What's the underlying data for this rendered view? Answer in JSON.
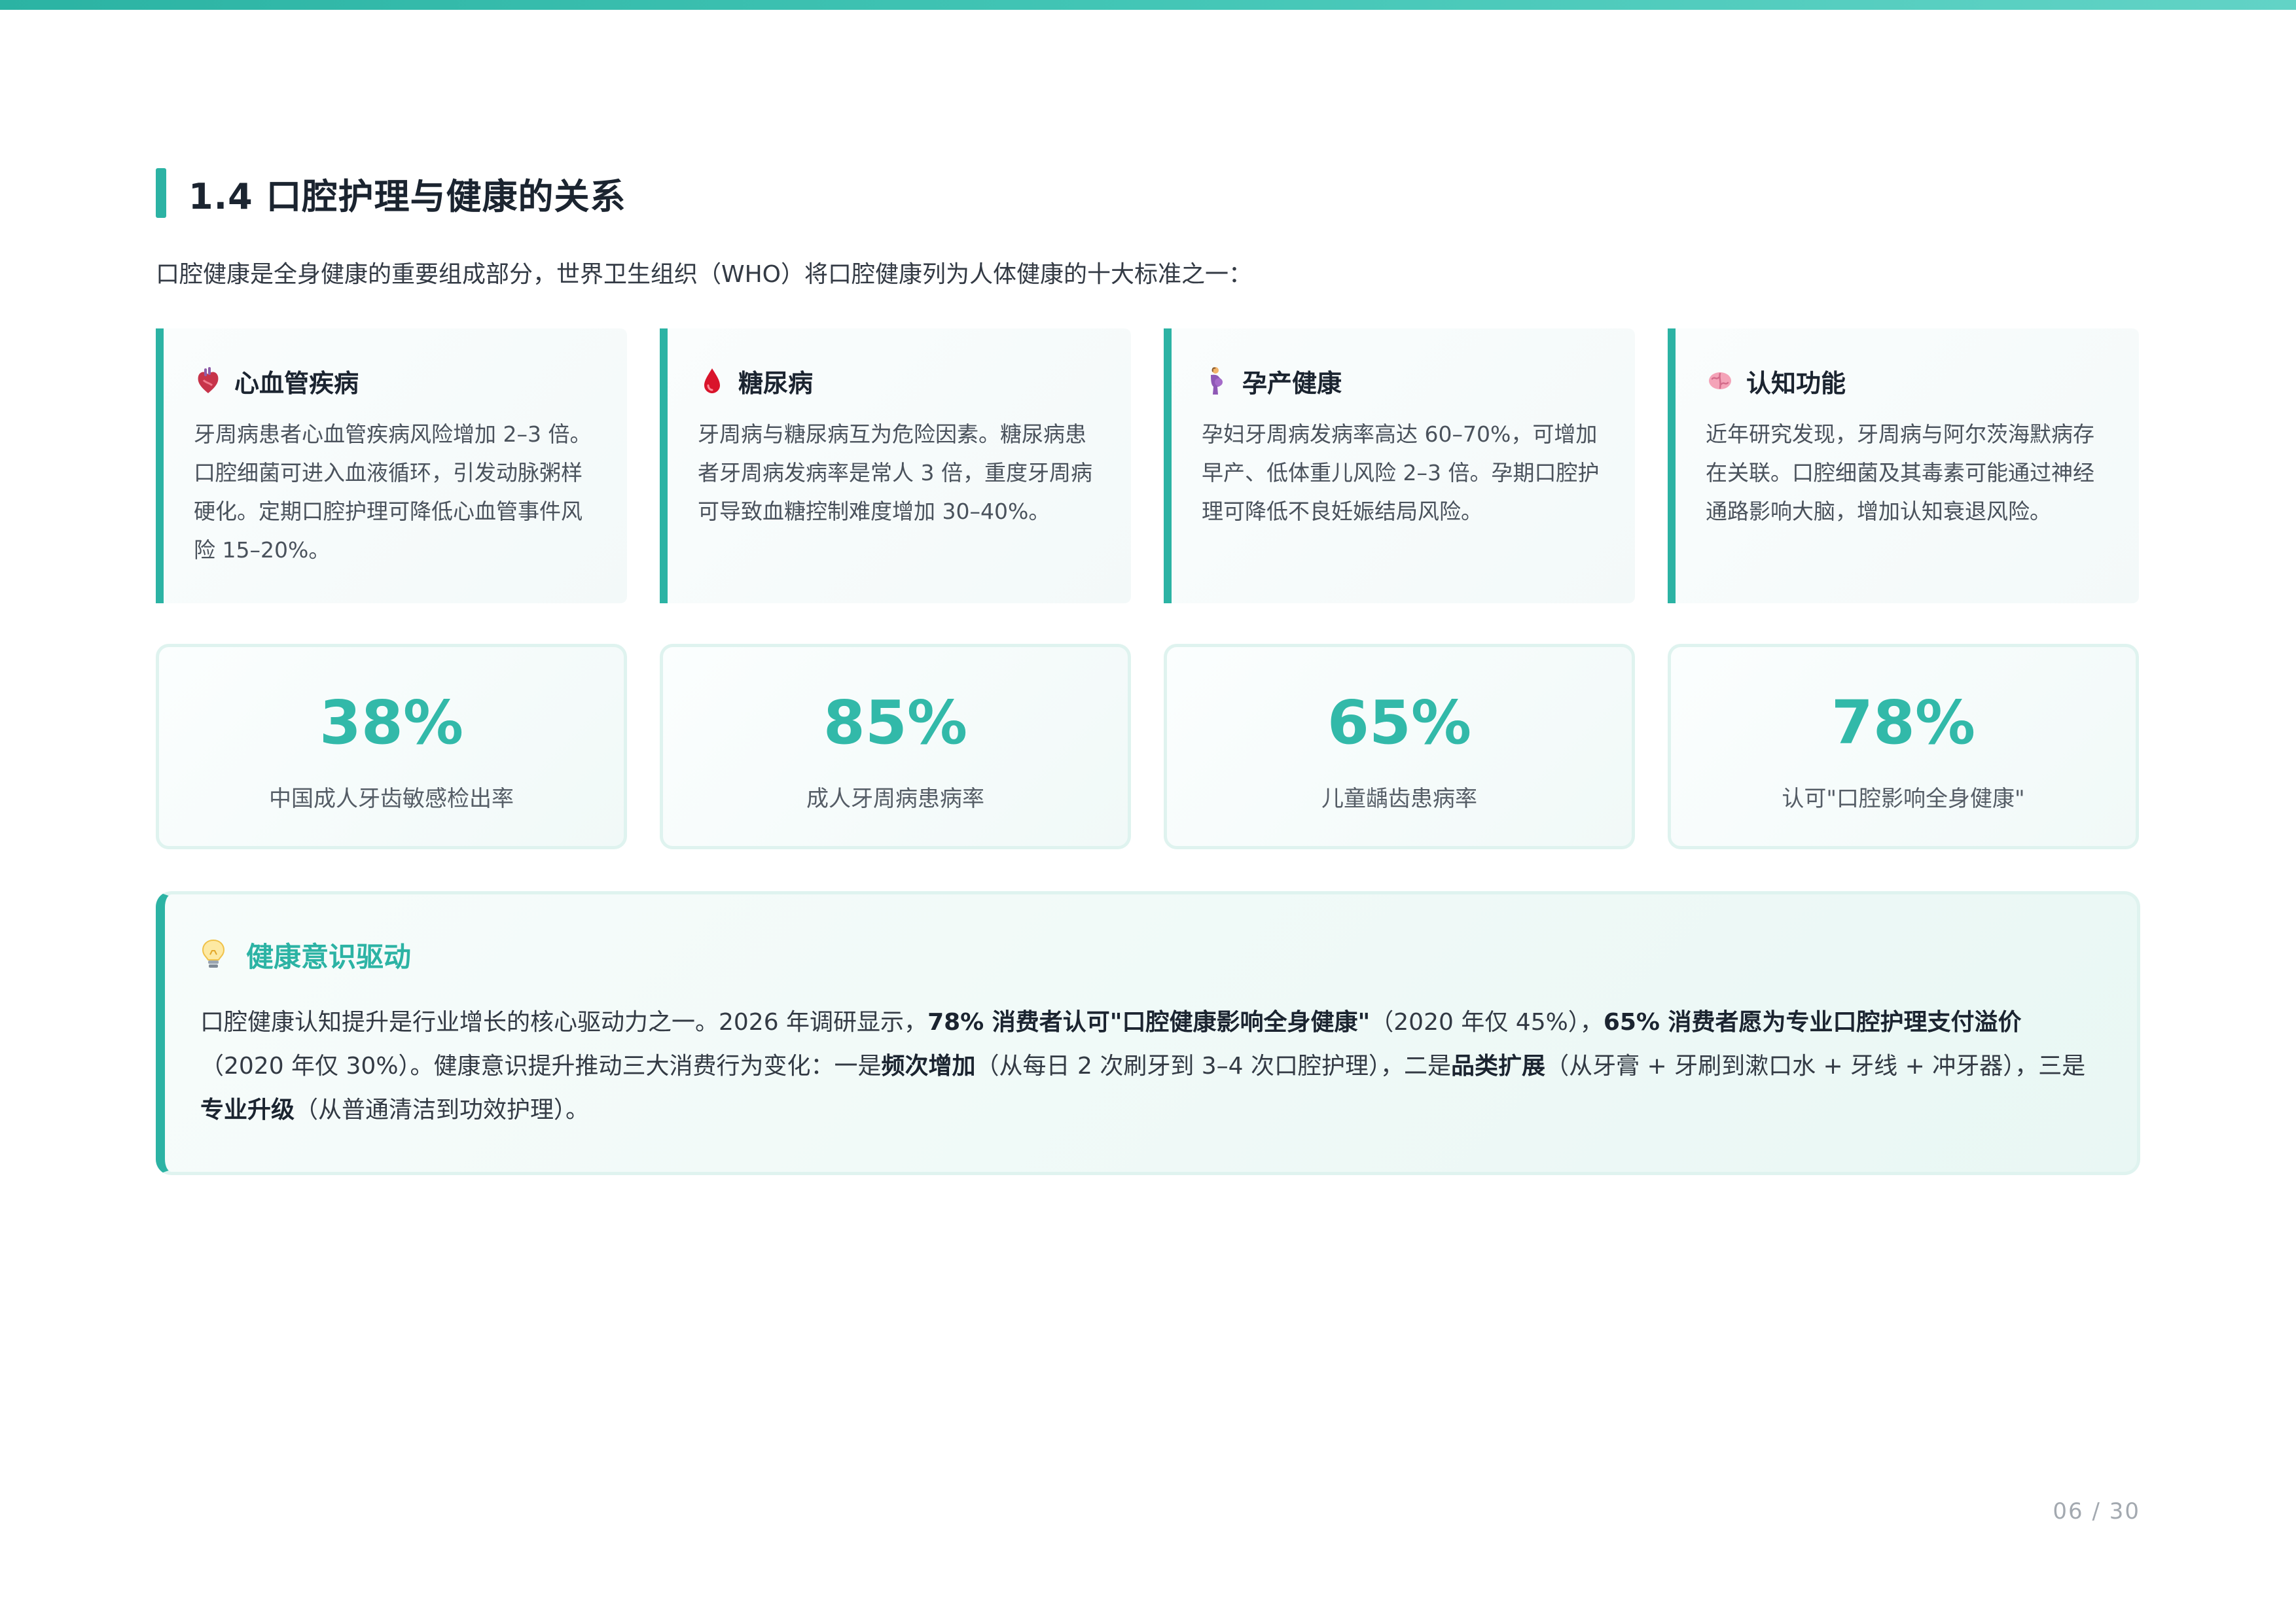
{
  "section": {
    "title": "1.4 口腔护理与健康的关系"
  },
  "intro": "口腔健康是全身健康的重要组成部分，世界卫生组织（WHO）将口腔健康列为人体健康的十大标准之一：",
  "cards": [
    {
      "icon": "heart-icon",
      "title": "心血管疾病",
      "text": "牙周病患者心血管疾病风险增加 2–3 倍。口腔细菌可进入血液循环，引发动脉粥样硬化。定期口腔护理可降低心血管事件风险 15–20%。"
    },
    {
      "icon": "blood-drop-icon",
      "title": "糖尿病",
      "text": "牙周病与糖尿病互为危险因素。糖尿病患者牙周病发病率是常人 3 倍，重度牙周病可导致血糖控制难度增加 30–40%。"
    },
    {
      "icon": "pregnant-woman-icon",
      "title": "孕产健康",
      "text": "孕妇牙周病发病率高达 60–70%，可增加早产、低体重儿风险 2–3 倍。孕期口腔护理可降低不良妊娠结局风险。"
    },
    {
      "icon": "brain-icon",
      "title": "认知功能",
      "text": "近年研究发现，牙周病与阿尔茨海默病存在关联。口腔细菌及其毒素可能通过神经通路影响大脑，增加认知衰退风险。"
    }
  ],
  "stats": [
    {
      "value": "38%",
      "label": "中国成人牙齿敏感检出率"
    },
    {
      "value": "85%",
      "label": "成人牙周病患病率"
    },
    {
      "value": "65%",
      "label": "儿童龋齿患病率"
    },
    {
      "value": "78%",
      "label": "认可\"口腔影响全身健康\""
    }
  ],
  "driver": {
    "icon": "lightbulb-icon",
    "title": "健康意识驱动",
    "p1": "口腔健康认知提升是行业增长的核心驱动力之一。2026 年调研显示，",
    "b1": "78% 消费者认可\"口腔健康影响全身健康\"",
    "p2": "（2020 年仅 45%），",
    "b2": "65% 消费者愿为专业口腔护理支付溢价",
    "p3": "（2020 年仅 30%）。健康意识提升推动三大消费行为变化：一是",
    "b3": "频次增加",
    "p4": "（从每日 2 次刷牙到 3–4 次口腔护理），二是",
    "b4": "品类扩展",
    "p5": "（从牙膏 + 牙刷到漱口水 + 牙线 + 冲牙器），三是",
    "b5": "专业升级",
    "p6": "（从普通清洁到功效护理）。"
  },
  "footer": {
    "page": "06 / 30"
  },
  "colors": {
    "accent": "#2cb3a4",
    "stat_value": "#32b9a9"
  }
}
